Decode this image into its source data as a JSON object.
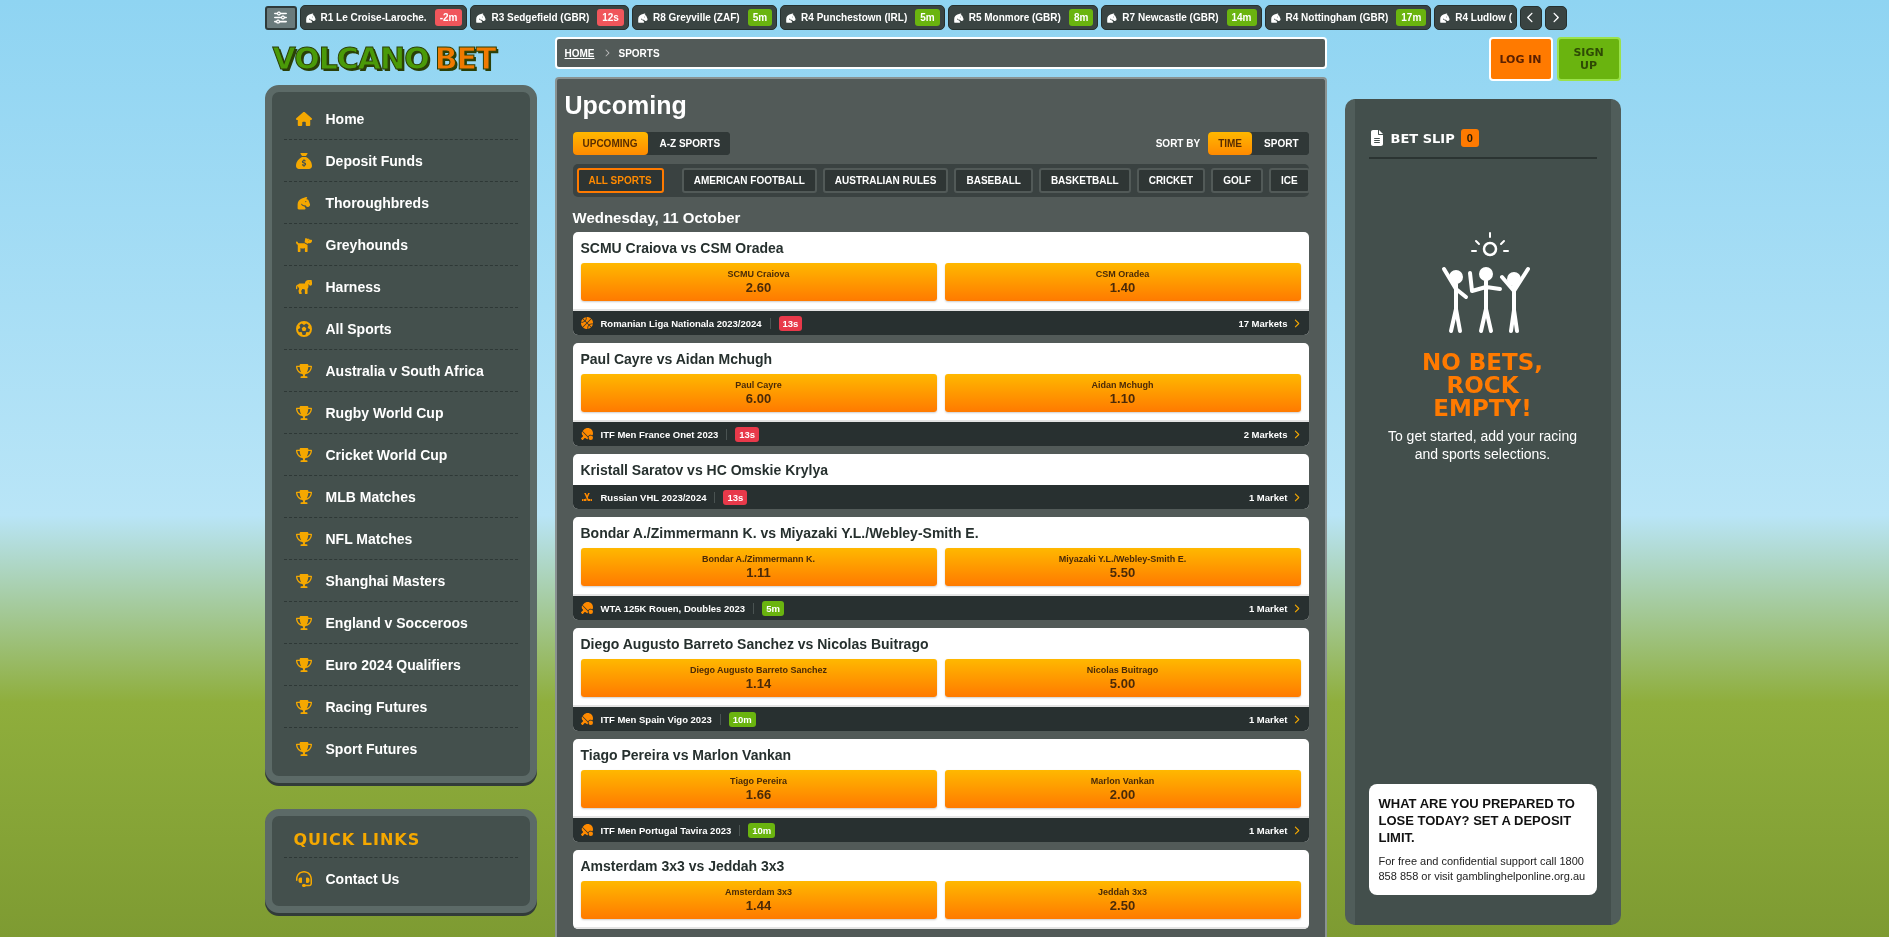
{
  "ticker": {
    "items": [
      {
        "name": "R1 Le Croise-Laroche.",
        "time": "-2m",
        "color": "#f0565b"
      },
      {
        "name": "R3 Sedgefield (GBR)",
        "time": "12s",
        "color": "#f0565b"
      },
      {
        "name": "R8 Greyville (ZAF)",
        "time": "5m",
        "color": "#6ab40f"
      },
      {
        "name": "R4 Punchestown (IRL)",
        "time": "5m",
        "color": "#6ab40f"
      },
      {
        "name": "R5 Monmore (GBR)",
        "time": "8m",
        "color": "#6ab40f"
      },
      {
        "name": "R7 Newcastle (GBR)",
        "time": "14m",
        "color": "#6ab40f"
      },
      {
        "name": "R4 Nottingham (GBR)",
        "time": "17m",
        "color": "#6ab40f"
      },
      {
        "name": "R4 Ludlow ("
      }
    ]
  },
  "logo": {
    "left": "VOLCANO",
    "right": "BET"
  },
  "nav": [
    {
      "label": "Home",
      "kind": "home"
    },
    {
      "label": "Deposit Funds",
      "kind": "deposit"
    },
    {
      "label": "Thoroughbreds",
      "kind": "horse"
    },
    {
      "label": "Greyhounds",
      "kind": "dog"
    },
    {
      "label": "Harness",
      "kind": "harness"
    },
    {
      "label": "All Sports",
      "kind": "sports"
    },
    {
      "label": "Australia v South Africa",
      "kind": "trophy"
    },
    {
      "label": "Rugby World Cup",
      "kind": "trophy"
    },
    {
      "label": "Cricket World Cup",
      "kind": "trophy"
    },
    {
      "label": "MLB Matches",
      "kind": "trophy"
    },
    {
      "label": "NFL Matches",
      "kind": "trophy"
    },
    {
      "label": "Shanghai Masters",
      "kind": "trophy"
    },
    {
      "label": "England v Socceroos",
      "kind": "trophy"
    },
    {
      "label": "Euro 2024 Qualifiers",
      "kind": "trophy"
    },
    {
      "label": "Racing Futures",
      "kind": "trophy"
    },
    {
      "label": "Sport Futures",
      "kind": "trophy"
    }
  ],
  "quick_links": {
    "title": "QUICK LINKS",
    "items": [
      {
        "label": "Contact Us",
        "kind": "contact"
      }
    ]
  },
  "breadcrumb": [
    {
      "label": "HOME",
      "link": true
    },
    {
      "label": "SPORTS",
      "link": false
    }
  ],
  "title": "Upcoming",
  "view_tabs": [
    {
      "label": "UPCOMING",
      "selected": true
    },
    {
      "label": "A-Z SPORTS",
      "selected": false
    }
  ],
  "sort": {
    "label": "SORT BY",
    "options": [
      {
        "label": "TIME",
        "selected": true
      },
      {
        "label": "SPORT",
        "selected": false
      }
    ]
  },
  "sport_filters": [
    {
      "label": "ALL SPORTS",
      "selected": true
    },
    {
      "label": "AMERICAN FOOTBALL",
      "selected": false
    },
    {
      "label": "AUSTRALIAN RULES",
      "selected": false
    },
    {
      "label": "BASEBALL",
      "selected": false
    },
    {
      "label": "BASKETBALL",
      "selected": false
    },
    {
      "label": "CRICKET",
      "selected": false
    },
    {
      "label": "GOLF",
      "selected": false
    },
    {
      "label": "ICE",
      "selected": false
    }
  ],
  "date": "Wednesday, 11 October",
  "events": [
    {
      "title": "SCMU Craiova vs CSM Oradea",
      "odds": [
        {
          "name": "SCMU Craiova",
          "price": "2.60"
        },
        {
          "name": "CSM Oradea",
          "price": "1.40"
        }
      ],
      "footer": {
        "kind": "basketball",
        "league": "Romanian Liga Nationala 2023/2024",
        "time": "13s",
        "color": "#e8394a",
        "markets": "17 Markets"
      }
    },
    {
      "title": "Paul Cayre vs Aidan Mchugh",
      "odds": [
        {
          "name": "Paul Cayre",
          "price": "6.00"
        },
        {
          "name": "Aidan Mchugh",
          "price": "1.10"
        }
      ],
      "footer": {
        "kind": "tennis",
        "league": "ITF Men France Onet 2023",
        "time": "13s",
        "color": "#e8394a",
        "markets": "2 Markets"
      }
    },
    {
      "title": "Kristall Saratov vs HC Omskie Krylya",
      "footer": {
        "kind": "hockey",
        "league": "Russian VHL 2023/2024",
        "time": "13s",
        "color": "#e8394a",
        "markets": "1 Market"
      }
    },
    {
      "title": "Bondar A./Zimmermann K. vs Miyazaki Y.L./Webley-Smith E.",
      "odds": [
        {
          "name": "Bondar A./Zimmermann K.",
          "price": "1.11"
        },
        {
          "name": "Miyazaki Y.L./Webley-Smith E.",
          "price": "5.50"
        }
      ],
      "footer": {
        "kind": "tennis",
        "league": "WTA 125K Rouen, Doubles 2023",
        "time": "5m",
        "color": "#6ab40f",
        "markets": "1 Market"
      }
    },
    {
      "title": "Diego Augusto Barreto Sanchez vs Nicolas Buitrago",
      "odds": [
        {
          "name": "Diego Augusto Barreto Sanchez",
          "price": "1.14"
        },
        {
          "name": "Nicolas Buitrago",
          "price": "5.00"
        }
      ],
      "footer": {
        "kind": "tennis",
        "league": "ITF Men Spain Vigo 2023",
        "time": "10m",
        "color": "#6ab40f",
        "markets": "1 Market"
      }
    },
    {
      "title": "Tiago Pereira vs Marlon Vankan",
      "odds": [
        {
          "name": "Tiago Pereira",
          "price": "1.66"
        },
        {
          "name": "Marlon Vankan",
          "price": "2.00"
        }
      ],
      "footer": {
        "kind": "tennis",
        "league": "ITF Men Portugal Tavira 2023",
        "time": "10m",
        "color": "#6ab40f",
        "markets": "1 Market"
      }
    },
    {
      "title": "Amsterdam 3x3 vs Jeddah 3x3",
      "odds": [
        {
          "name": "Amsterdam 3x3",
          "price": "1.44"
        },
        {
          "name": "Jeddah 3x3",
          "price": "2.50"
        }
      ]
    }
  ],
  "auth": [
    {
      "label": "LOG IN",
      "kind": "login"
    },
    {
      "label": "SIGN UP",
      "kind": "signup"
    }
  ],
  "bet_slip": {
    "title": "BET SLIP",
    "count": "0",
    "empty_title": "NO BETS, ROCK EMPTY!",
    "empty_text": "To get started, add your racing and sports selections.",
    "notice": {
      "title": "WHAT ARE YOU PREPARED TO LOSE TODAY? SET A DEPOSIT LIMIT.",
      "text": "For free and confidential support call 1800 858 858 or visit gamblinghelponline.org.au"
    }
  }
}
